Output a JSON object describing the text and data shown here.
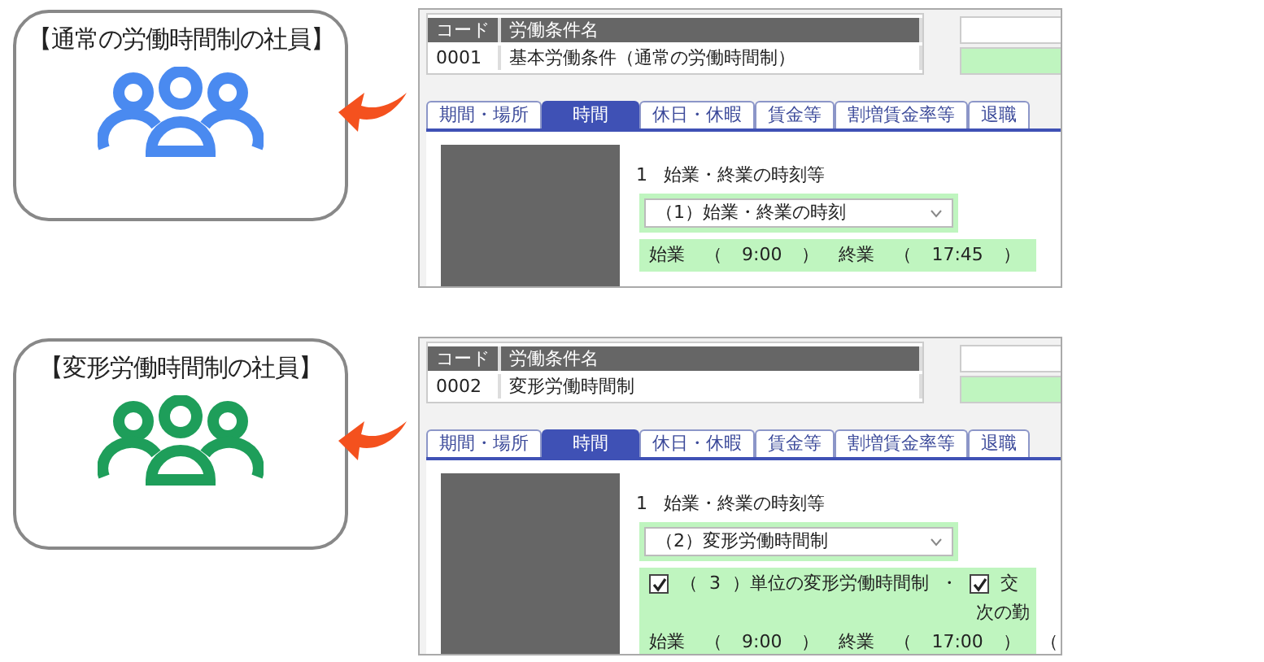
{
  "cases": [
    {
      "title": "【通常の労働時間制の社員】",
      "color": "#4a8af0",
      "columns": [
        "コード",
        "労働条件名"
      ],
      "code": "0001",
      "name": "基本労働条件（通常の労働時間制）",
      "tabs": [
        {
          "label": "期間・場所",
          "selected": false
        },
        {
          "label": "時間",
          "selected": true
        },
        {
          "label": "休日・休暇",
          "selected": false
        },
        {
          "label": "賃金等",
          "selected": false
        },
        {
          "label": "割増賃金率等",
          "selected": false
        },
        {
          "label": "退職",
          "selected": false
        }
      ],
      "heading_number": "1",
      "heading": "始業・終業の時刻等",
      "select_value": "（1）始業・終業の時刻",
      "lines": [
        {
          "kind": "times",
          "cells": [
            "始業",
            "（",
            "9:00",
            "）",
            "終業",
            "（",
            "17:45",
            "）"
          ]
        }
      ]
    },
    {
      "title": "【変形労働時間制の社員】",
      "color": "#1e9e5a",
      "columns": [
        "コード",
        "労働条件名"
      ],
      "code": "0002",
      "name": "変形労働時間制",
      "tabs": [
        {
          "label": "期間・場所",
          "selected": false
        },
        {
          "label": "時間",
          "selected": true
        },
        {
          "label": "休日・休暇",
          "selected": false
        },
        {
          "label": "賃金等",
          "selected": false
        },
        {
          "label": "割増賃金率等",
          "selected": false
        },
        {
          "label": "退職",
          "selected": false
        }
      ],
      "heading_number": "1",
      "heading": "始業・終業の時刻等",
      "select_value": "（2）変形労働時間制",
      "lines": [
        {
          "kind": "checks",
          "parts": [
            {
              "kind": "checkbox",
              "checked": true
            },
            {
              "kind": "text",
              "text": "（"
            },
            {
              "kind": "text",
              "text": "3"
            },
            {
              "kind": "text",
              "text": "）単位の変形労働時間制"
            },
            {
              "kind": "text",
              "text": "・"
            },
            {
              "kind": "checkbox",
              "checked": true
            },
            {
              "kind": "text",
              "text": "交"
            }
          ]
        },
        {
          "kind": "note",
          "text": "次の勤"
        },
        {
          "kind": "times",
          "cells": [
            "始業",
            "（",
            "9:00",
            "）",
            "終業",
            "（",
            "17:00",
            "）",
            "（"
          ]
        }
      ]
    }
  ]
}
